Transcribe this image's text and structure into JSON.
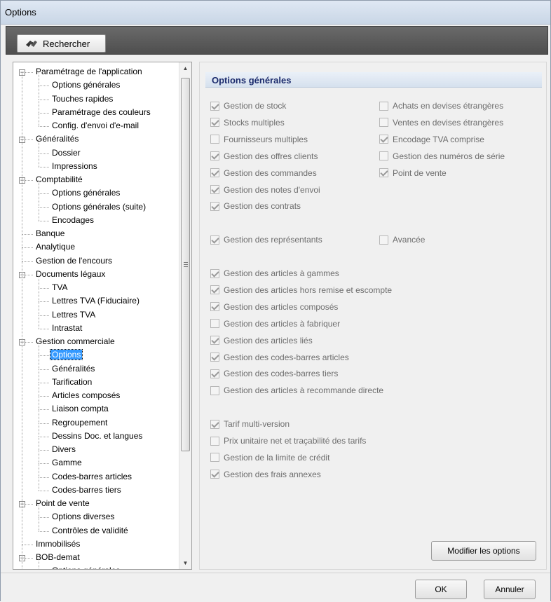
{
  "window": {
    "title": "Options"
  },
  "toolbar": {
    "search_label": "Rechercher",
    "search_icon": "binoculars-icon"
  },
  "tree": {
    "items": [
      {
        "label": "Paramétrage de l'application",
        "level": 0,
        "expander": "−"
      },
      {
        "label": "Options générales",
        "level": 1
      },
      {
        "label": "Touches rapides",
        "level": 1
      },
      {
        "label": "Paramétrage des couleurs",
        "level": 1
      },
      {
        "label": "Config. d'envoi d'e-mail",
        "level": 1
      },
      {
        "label": "Généralités",
        "level": 0,
        "expander": "−"
      },
      {
        "label": "Dossier",
        "level": 1
      },
      {
        "label": "Impressions",
        "level": 1
      },
      {
        "label": "Comptabilité",
        "level": 0,
        "expander": "−"
      },
      {
        "label": "Options générales",
        "level": 1
      },
      {
        "label": "Options générales (suite)",
        "level": 1
      },
      {
        "label": "Encodages",
        "level": 1
      },
      {
        "label": "Banque",
        "level": 0
      },
      {
        "label": "Analytique",
        "level": 0
      },
      {
        "label": "Gestion de l'encours",
        "level": 0
      },
      {
        "label": "Documents légaux",
        "level": 0,
        "expander": "−"
      },
      {
        "label": "TVA",
        "level": 1
      },
      {
        "label": "Lettres TVA (Fiduciaire)",
        "level": 1
      },
      {
        "label": "Lettres TVA",
        "level": 1
      },
      {
        "label": "Intrastat",
        "level": 1
      },
      {
        "label": "Gestion commerciale",
        "level": 0,
        "expander": "−"
      },
      {
        "label": "Options",
        "level": 1,
        "selected": true
      },
      {
        "label": "Généralités",
        "level": 1
      },
      {
        "label": "Tarification",
        "level": 1
      },
      {
        "label": "Articles composés",
        "level": 1
      },
      {
        "label": "Liaison compta",
        "level": 1
      },
      {
        "label": "Regroupement",
        "level": 1
      },
      {
        "label": "Dessins Doc. et langues",
        "level": 1
      },
      {
        "label": "Divers",
        "level": 1
      },
      {
        "label": "Gamme",
        "level": 1
      },
      {
        "label": "Codes-barres articles",
        "level": 1
      },
      {
        "label": "Codes-barres tiers",
        "level": 1
      },
      {
        "label": "Point de vente",
        "level": 0,
        "expander": "−"
      },
      {
        "label": "Options diverses",
        "level": 1
      },
      {
        "label": "Contrôles de validité",
        "level": 1
      },
      {
        "label": "Immobilisés",
        "level": 0
      },
      {
        "label": "BOB-demat",
        "level": 0,
        "expander": "−"
      },
      {
        "label": "Options générales",
        "level": 1
      }
    ]
  },
  "section": {
    "title": "Options générales"
  },
  "options": [
    {
      "label": "Gestion de stock",
      "checked": true,
      "col": 0,
      "row": 0
    },
    {
      "label": "Achats en devises étrangères",
      "checked": false,
      "col": 1,
      "row": 0
    },
    {
      "label": "Stocks multiples",
      "checked": true,
      "col": 0,
      "row": 1
    },
    {
      "label": "Ventes en devises étrangères",
      "checked": false,
      "col": 1,
      "row": 1
    },
    {
      "label": "Fournisseurs multiples",
      "checked": false,
      "col": 0,
      "row": 2
    },
    {
      "label": "Encodage TVA comprise",
      "checked": true,
      "col": 1,
      "row": 2
    },
    {
      "label": "Gestion des offres clients",
      "checked": true,
      "col": 0,
      "row": 3
    },
    {
      "label": "Gestion des numéros de série",
      "checked": false,
      "col": 1,
      "row": 3
    },
    {
      "label": "Gestion des commandes",
      "checked": true,
      "col": 0,
      "row": 4
    },
    {
      "label": "Point de vente",
      "checked": true,
      "col": 1,
      "row": 4
    },
    {
      "label": "Gestion des notes d'envoi",
      "checked": true,
      "col": 0,
      "row": 5
    },
    {
      "label": "Gestion des contrats",
      "checked": true,
      "col": 0,
      "row": 6
    },
    {
      "label": "Gestion des représentants",
      "checked": true,
      "col": 0,
      "row": 8
    },
    {
      "label": "Avancée",
      "checked": false,
      "col": 1,
      "row": 8
    },
    {
      "label": "Gestion des articles à gammes",
      "checked": true,
      "col": 0,
      "row": 10
    },
    {
      "label": "Gestion des articles hors remise et escompte",
      "checked": true,
      "col": 0,
      "row": 11
    },
    {
      "label": "Gestion des articles composés",
      "checked": true,
      "col": 0,
      "row": 12
    },
    {
      "label": "Gestion des articles à fabriquer",
      "checked": false,
      "col": 0,
      "row": 13
    },
    {
      "label": "Gestion des articles liés",
      "checked": true,
      "col": 0,
      "row": 14
    },
    {
      "label": "Gestion des codes-barres articles",
      "checked": true,
      "col": 0,
      "row": 15
    },
    {
      "label": "Gestion des codes-barres tiers",
      "checked": true,
      "col": 0,
      "row": 16
    },
    {
      "label": "Gestion des articles à recommande directe",
      "checked": false,
      "col": 0,
      "row": 17
    },
    {
      "label": "Tarif multi-version",
      "checked": true,
      "col": 0,
      "row": 19
    },
    {
      "label": "Prix unitaire net et traçabilité des tarifs",
      "checked": false,
      "col": 0,
      "row": 20
    },
    {
      "label": "Gestion de la limite de crédit",
      "checked": false,
      "col": 0,
      "row": 21
    },
    {
      "label": "Gestion des frais annexes",
      "checked": true,
      "col": 0,
      "row": 22
    }
  ],
  "buttons": {
    "modify": "Modifier les options",
    "ok": "OK",
    "cancel": "Annuler"
  }
}
